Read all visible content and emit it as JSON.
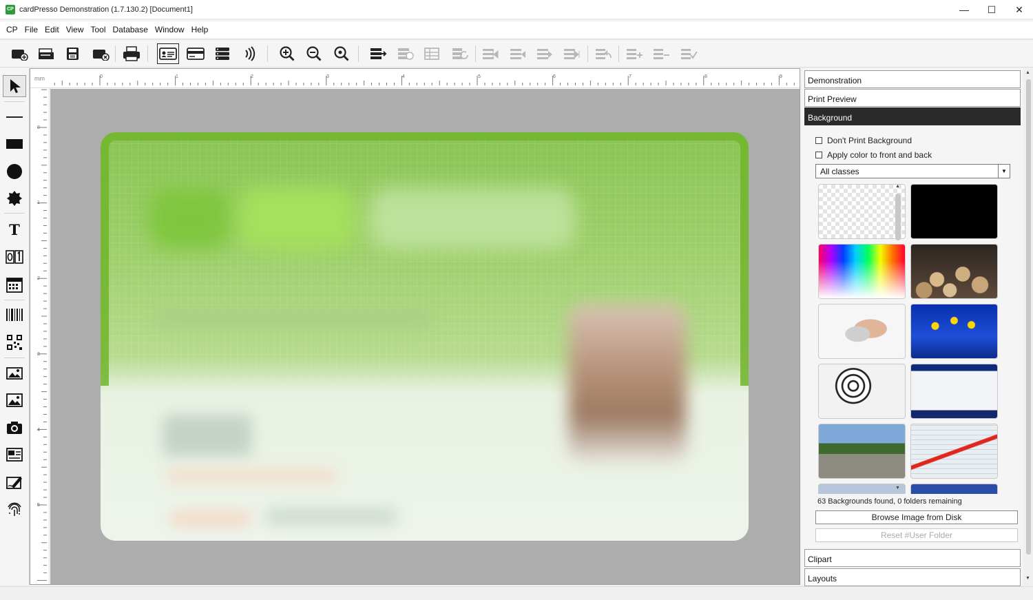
{
  "window": {
    "app_icon": "CP",
    "title": "cardPresso Demonstration (1.7.130.2) [Document1]",
    "minimize": "—",
    "maximize": "☐",
    "close": "✕"
  },
  "menu": [
    "CP",
    "File",
    "Edit",
    "View",
    "Tool",
    "Database",
    "Window",
    "Help"
  ],
  "ruler": {
    "unit": "mm",
    "top_labels": [
      "0",
      "1",
      "2",
      "3",
      "4",
      "5",
      "6",
      "7",
      "8",
      "9"
    ],
    "left_labels": [
      "0",
      "1",
      "2",
      "3",
      "4",
      "5"
    ]
  },
  "panel": {
    "sections": [
      "Demonstration",
      "Print Preview",
      "Background"
    ],
    "bottom_sections": [
      "Clipart",
      "Layouts"
    ],
    "background": {
      "dont_print": "Don't Print Background",
      "apply_color": "Apply color to front and back",
      "class_select": "All classes",
      "thumbnails": [
        "transparent",
        "black",
        "spectrum",
        "clocks",
        "phone",
        "daffodils",
        "love-target",
        "calendar",
        "truck",
        "notebook-pen"
      ],
      "found_text": "63 Backgrounds found, 0 folders remaining",
      "browse_button": "Browse Image from Disk",
      "reset_button": "Reset #User Folder"
    }
  },
  "colors": {
    "card_green": "#71b52c",
    "selected_header": "#2a2a2a",
    "workspace": "#adadad"
  }
}
